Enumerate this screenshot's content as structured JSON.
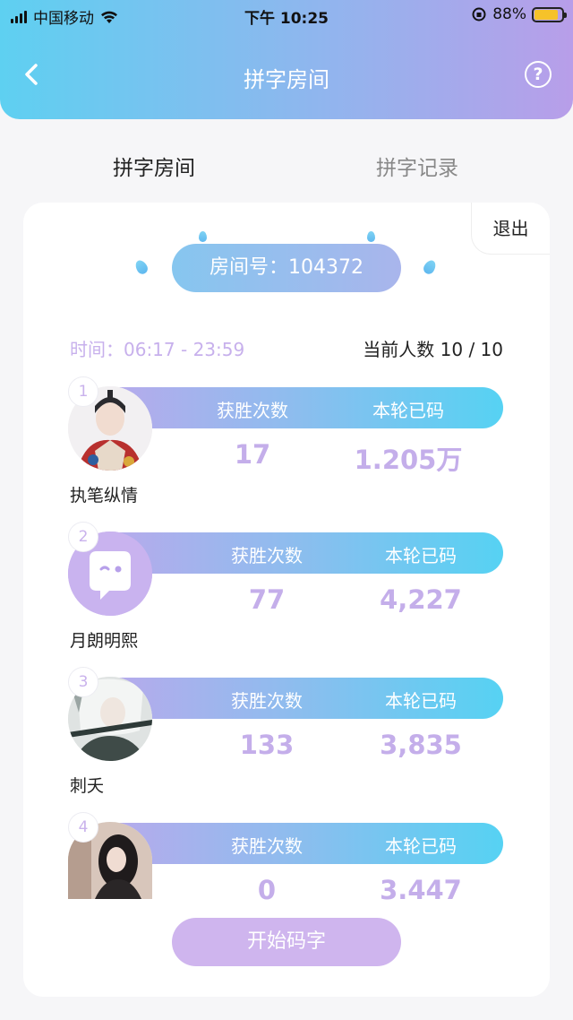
{
  "status": {
    "carrier": "中国移动",
    "time": "下午 10:25",
    "battery": "88%"
  },
  "nav": {
    "title": "拼字房间",
    "help": "?"
  },
  "tabs": [
    {
      "label": "拼字房间"
    },
    {
      "label": "拼字记录"
    }
  ],
  "room": {
    "exit": "退出",
    "label": "房间号：104372",
    "time": "时间：06:17 - 23:59",
    "count": "当前人数 10 / 10"
  },
  "players": [
    {
      "rank": "1",
      "name": "执笔纵情",
      "wins_label": "获胜次数",
      "typed_label": "本轮已码",
      "wins": "17",
      "typed": "1.205万"
    },
    {
      "rank": "2",
      "name": "月朗明熙",
      "wins_label": "获胜次数",
      "typed_label": "本轮已码",
      "wins": "77",
      "typed": "4,227"
    },
    {
      "rank": "3",
      "name": "刺夭",
      "wins_label": "获胜次数",
      "typed_label": "本轮已码",
      "wins": "133",
      "typed": "3,835"
    },
    {
      "rank": "4",
      "name": "",
      "wins_label": "获胜次数",
      "typed_label": "本轮已码",
      "wins": "0",
      "typed": "3.447"
    }
  ],
  "start_button": "开始码字",
  "colors": {
    "accent_purple": "#c4aeea",
    "accent_blue": "#56d2f3",
    "header_left": "#5ed0f1",
    "header_right": "#b89ee9"
  }
}
